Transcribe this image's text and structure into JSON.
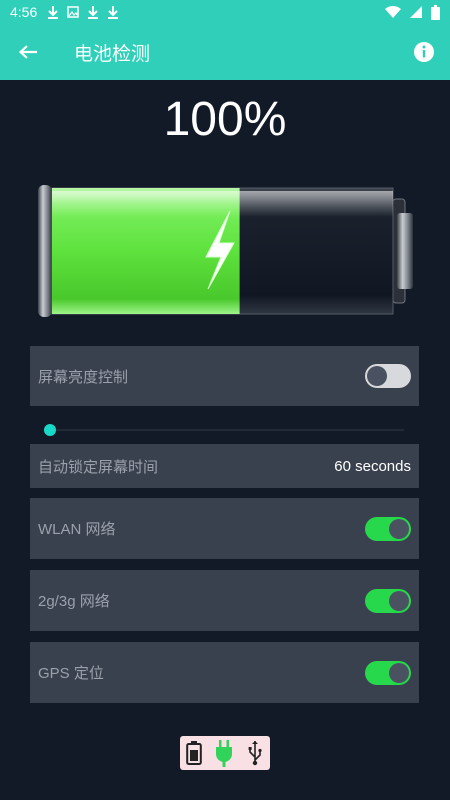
{
  "status_bar": {
    "time": "4:56"
  },
  "app_bar": {
    "title": "电池检测"
  },
  "battery": {
    "percent_text": "100%",
    "fill_fraction": 0.55
  },
  "settings": {
    "brightness": {
      "label": "屏幕亮度控制",
      "toggle_on": false
    },
    "brightness_slider": {
      "value": 0
    },
    "auto_lock": {
      "label": "自动锁定屏幕时间",
      "value": "60 seconds"
    },
    "wlan": {
      "label": "WLAN 网络",
      "toggle_on": true
    },
    "mobile": {
      "label": "2g/3g 网络",
      "toggle_on": true
    },
    "gps": {
      "label": "GPS 定位",
      "toggle_on": true
    }
  },
  "icons": {
    "status": [
      "download-icon",
      "image-icon",
      "download-icon",
      "download-icon",
      "wifi-icon",
      "signal-icon",
      "battery-icon"
    ],
    "app_bar": [
      "back-arrow-icon",
      "info-icon"
    ],
    "bottom": [
      "battery-icon",
      "charger-plug-icon",
      "usb-icon"
    ]
  },
  "colors": {
    "accent": "#2fcfb9",
    "background": "#131a27",
    "row": "#3a414e",
    "toggle_on": "#28d84c",
    "slider": "#18d8c8"
  }
}
